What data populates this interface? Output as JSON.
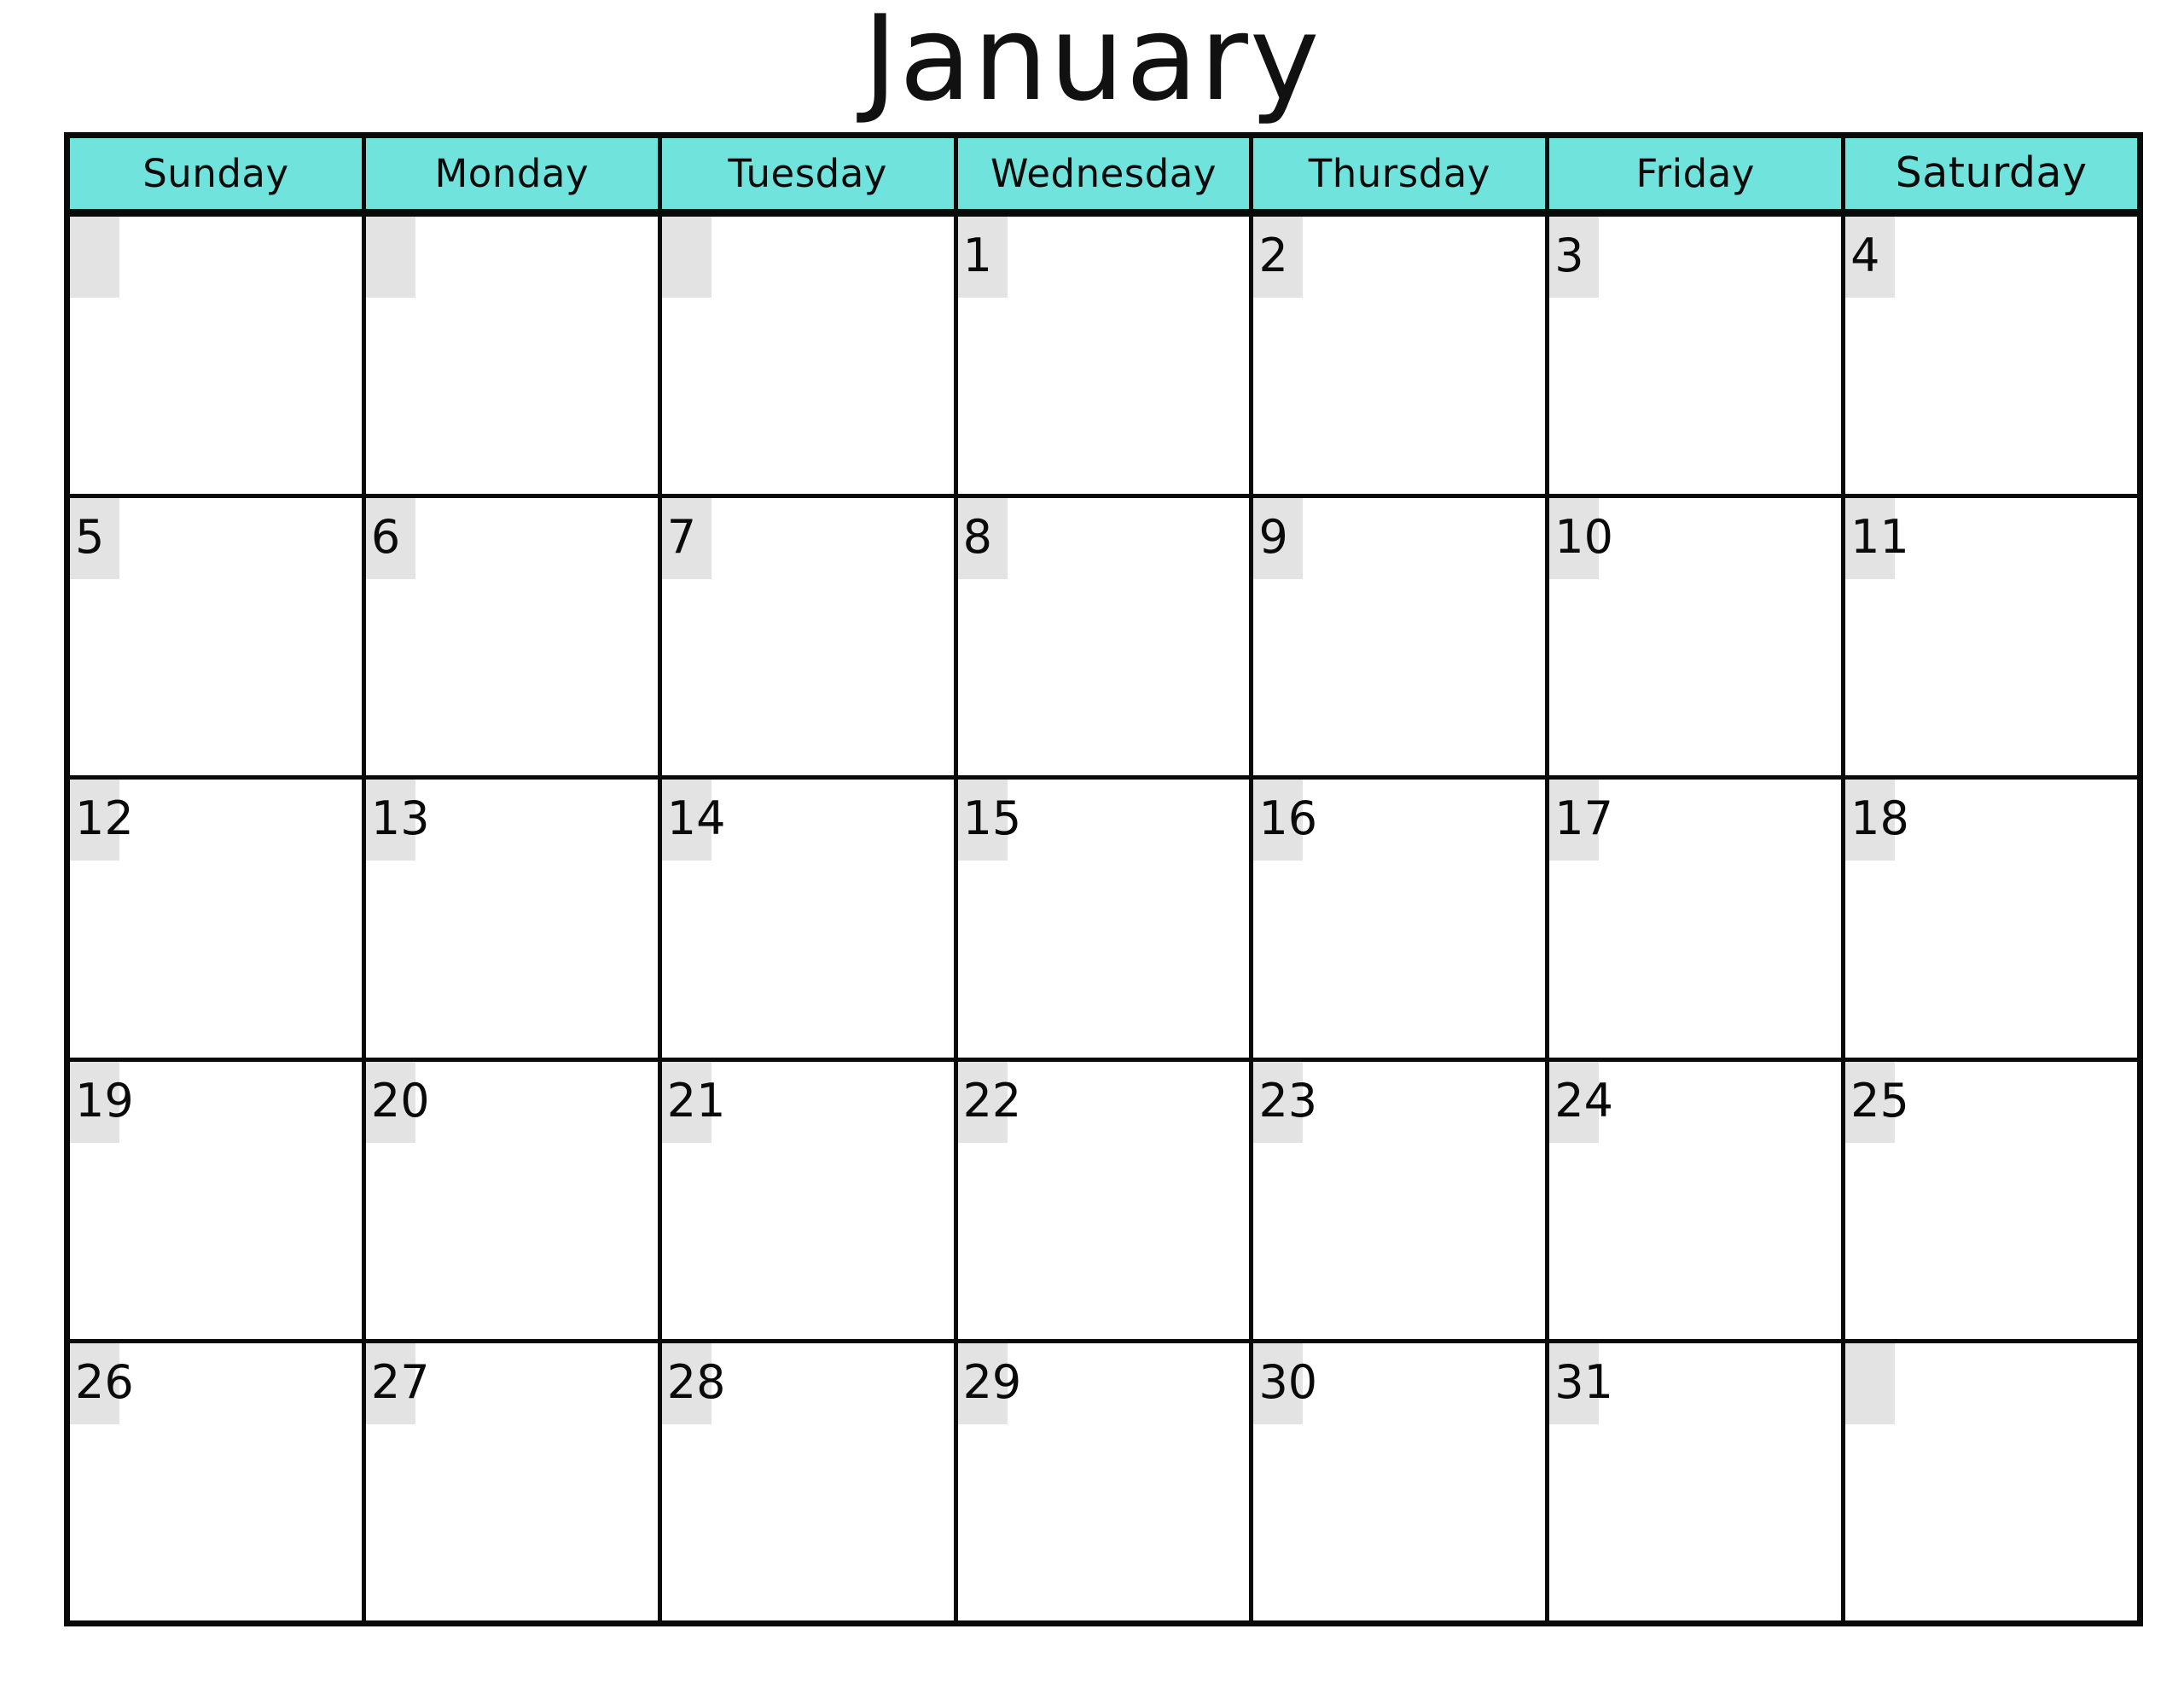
{
  "title": "January",
  "colors": {
    "header_background": "#6FE3DC",
    "day_number_chip": "#E3E3E3",
    "grid_line": "#0A0A0A",
    "cell_background": "#FFFFFF",
    "text": "#0A0A0A"
  },
  "weekdays": [
    {
      "label": "Sunday",
      "key": "sunday"
    },
    {
      "label": "Monday",
      "key": "monday"
    },
    {
      "label": "Tuesday",
      "key": "tuesday"
    },
    {
      "label": "Wednesday",
      "key": "wednesday"
    },
    {
      "label": "Thursday",
      "key": "thursday"
    },
    {
      "label": "Friday",
      "key": "friday"
    },
    {
      "label": "Saturday",
      "key": "saturday"
    }
  ],
  "weeks": [
    {
      "days": [
        {
          "date": ""
        },
        {
          "date": ""
        },
        {
          "date": ""
        },
        {
          "date": "1"
        },
        {
          "date": "2"
        },
        {
          "date": "3"
        },
        {
          "date": "4"
        }
      ]
    },
    {
      "days": [
        {
          "date": "5"
        },
        {
          "date": "6"
        },
        {
          "date": "7"
        },
        {
          "date": "8"
        },
        {
          "date": "9"
        },
        {
          "date": "10"
        },
        {
          "date": "11"
        }
      ]
    },
    {
      "days": [
        {
          "date": "12"
        },
        {
          "date": "13"
        },
        {
          "date": "14"
        },
        {
          "date": "15"
        },
        {
          "date": "16"
        },
        {
          "date": "17"
        },
        {
          "date": "18"
        }
      ]
    },
    {
      "days": [
        {
          "date": "19"
        },
        {
          "date": "20"
        },
        {
          "date": "21"
        },
        {
          "date": "22"
        },
        {
          "date": "23"
        },
        {
          "date": "24"
        },
        {
          "date": "25"
        }
      ]
    },
    {
      "days": [
        {
          "date": "26"
        },
        {
          "date": "27"
        },
        {
          "date": "28"
        },
        {
          "date": "29"
        },
        {
          "date": "30"
        },
        {
          "date": "31"
        },
        {
          "date": ""
        }
      ]
    }
  ]
}
